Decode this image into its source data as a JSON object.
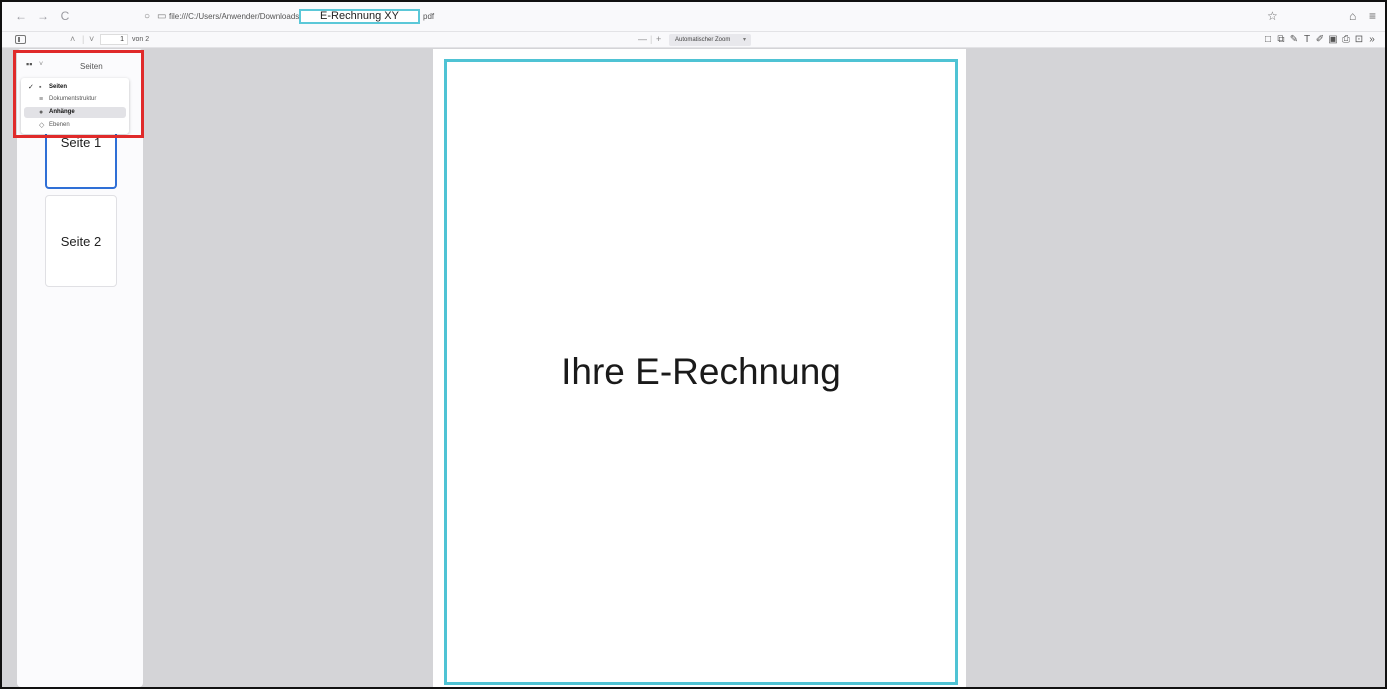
{
  "urlbar": {
    "back": "←",
    "forward": "→",
    "reload": "C",
    "url_path": "file:///C:/Users/Anwender/Downloads/",
    "file_name": "E-Rechnung XY",
    "file_ext": "pdf",
    "star": "☆",
    "home": "⌂",
    "menu": "≡"
  },
  "pdf_toolbar": {
    "prev": "˄",
    "next": "˅",
    "page_number": "1",
    "page_count": "von 2",
    "zoom_out": "—",
    "zoom_in": "+",
    "zoom_value": "Automatischer Zoom",
    "tools": [
      "□",
      "⧉",
      "✎",
      "T",
      "✐",
      "▣",
      "⎙",
      "⊡",
      "»"
    ]
  },
  "sidebar": {
    "title": "Seiten",
    "menu_items": [
      {
        "label": "Seiten",
        "icon": "grid-icon",
        "checked": true
      },
      {
        "label": "Dokumentstruktur",
        "icon": "outline-icon",
        "checked": false
      },
      {
        "label": "Anhänge",
        "icon": "paperclip-icon",
        "checked": false,
        "highlighted": true
      },
      {
        "label": "Ebenen",
        "icon": "layers-icon",
        "checked": false
      }
    ],
    "thumbnails": [
      {
        "label": "Seite 1"
      },
      {
        "label": "Seite 2"
      }
    ]
  },
  "document": {
    "heading": "Ihre E-Rechnung"
  },
  "colors": {
    "highlight_red": "#e02a2a",
    "page_border": "#4fc3d4",
    "active_thumb": "#2f6fd6"
  }
}
